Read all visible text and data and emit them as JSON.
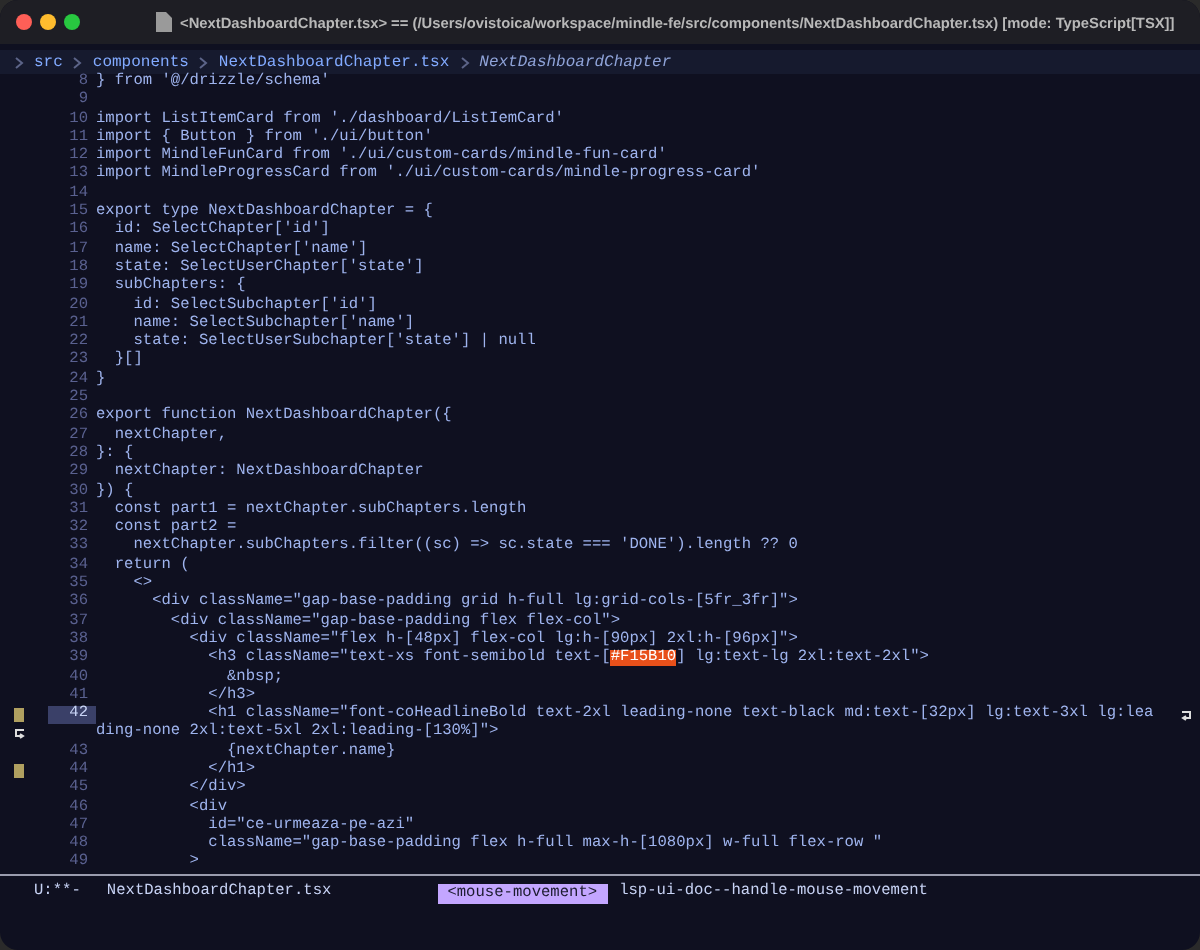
{
  "window": {
    "title": "<NextDashboardChapter.tsx> == (/Users/ovistoica/workspace/mindle-fe/src/components/NextDashboardChapter.tsx) [mode: TypeScript[TSX]]"
  },
  "breadcrumb": [
    "src",
    "components",
    "NextDashboardChapter.tsx",
    "NextDashboardChapter"
  ],
  "lines": [
    {
      "n": "8",
      "text": "} from '@/drizzle/schema'",
      "current": false,
      "marker": false
    },
    {
      "n": "9",
      "current": false,
      "marker": false
    },
    {
      "n": "10",
      "text": "import ListItemCard from './dashboard/ListIemCard'",
      "current": false,
      "marker": false
    },
    {
      "n": "11",
      "text": "import { Button } from './ui/button'",
      "current": false,
      "marker": false
    },
    {
      "n": "12",
      "text": "import MindleFunCard from './ui/custom-cards/mindle-fun-card'",
      "current": false,
      "marker": false
    },
    {
      "n": "13",
      "text": "import MindleProgressCard from './ui/custom-cards/mindle-progress-card'",
      "current": false,
      "marker": false
    },
    {
      "n": "14",
      "current": false,
      "marker": false
    },
    {
      "n": "15",
      "text": "export type NextDashboardChapter = {",
      "current": false,
      "marker": false
    },
    {
      "n": "16",
      "text": "  id: SelectChapter['id']",
      "current": false,
      "marker": false
    },
    {
      "n": "17",
      "text": "  name: SelectChapter['name']",
      "current": false,
      "marker": false
    },
    {
      "n": "18",
      "text": "  state: SelectUserChapter['state']",
      "current": false,
      "marker": false
    },
    {
      "n": "19",
      "text": "  subChapters: {",
      "current": false,
      "marker": false
    },
    {
      "n": "20",
      "text": "    id: SelectSubchapter['id']",
      "current": false,
      "marker": false
    },
    {
      "n": "21",
      "text": "    name: SelectSubchapter['name']",
      "current": false,
      "marker": false
    },
    {
      "n": "22",
      "text": "    state: SelectUserSubchapter['state'] | null",
      "current": false,
      "marker": false
    },
    {
      "n": "23",
      "text": "  }[]",
      "current": false,
      "marker": false
    },
    {
      "n": "24",
      "text": "}",
      "current": false,
      "marker": false
    },
    {
      "n": "25",
      "current": false,
      "marker": false
    },
    {
      "n": "26",
      "text": "export function NextDashboardChapter({",
      "current": false,
      "marker": false
    },
    {
      "n": "27",
      "text": "  nextChapter,",
      "current": false,
      "marker": false
    },
    {
      "n": "28",
      "text": "}: {",
      "current": false,
      "marker": false
    },
    {
      "n": "29",
      "text": "  nextChapter: NextDashboardChapter",
      "current": false,
      "marker": false
    },
    {
      "n": "30",
      "text": "}) {",
      "current": false,
      "marker": false
    },
    {
      "n": "31",
      "text": "  const part1 = nextChapter.subChapters.length",
      "current": false,
      "marker": false
    },
    {
      "n": "32",
      "text": "  const part2 =",
      "current": false,
      "marker": false
    },
    {
      "n": "33",
      "text": "    nextChapter.subChapters.filter((sc) => sc.state === 'DONE').length ?? 0",
      "current": false,
      "marker": false
    },
    {
      "n": "34",
      "text": "  return (",
      "current": false,
      "marker": false
    },
    {
      "n": "35",
      "text": "    <>",
      "current": false,
      "marker": false
    },
    {
      "n": "36",
      "text": "      <div className=\"gap-base-padding grid h-full lg:grid-cols-[5fr_3fr]\">",
      "current": false,
      "marker": false
    },
    {
      "n": "37",
      "text": "        <div className=\"gap-base-padding flex flex-col\">",
      "current": false,
      "marker": false
    },
    {
      "n": "38",
      "text": "          <div className=\"flex h-[48px] flex-col lg:h-[90px] 2xl:h-[96px]\">",
      "current": false,
      "marker": false
    },
    {
      "n": "39",
      "text": "            <h3 className=\"text-xs font-semibold text-[",
      "highlight": "#F15B10",
      "after": "] lg:text-lg 2xl:text-2xl\">",
      "current": false,
      "marker": false
    },
    {
      "n": "40",
      "text": "              &nbsp;",
      "current": false,
      "marker": false
    },
    {
      "n": "41",
      "text": "            </h3>",
      "current": false,
      "marker": false
    },
    {
      "n": "42",
      "text": "            <h1 className=\"font-coHeadlineBold text-2xl leading-none text-black md:text-[32px] lg:text-3xl lg:lea",
      "continuation": "ding-none 2xl:text-5xl 2xl:leading-[130%]\">",
      "current": true,
      "marker": true
    },
    {
      "n": "43",
      "text": "              {nextChapter.name}",
      "current": false,
      "marker": false
    },
    {
      "n": "44",
      "text": "            </h1>",
      "current": false,
      "marker": true
    },
    {
      "n": "45",
      "text": "          </div>",
      "current": false,
      "marker": false
    },
    {
      "n": "46",
      "text": "          <div",
      "current": false,
      "marker": false
    },
    {
      "n": "47",
      "text": "            id=\"ce-urmeaza-pe-azi\"",
      "current": false,
      "marker": false
    },
    {
      "n": "48",
      "text": "            className=\"gap-base-padding flex h-full max-h-[1080px] w-full flex-row \"",
      "current": false,
      "marker": false
    },
    {
      "n": "49",
      "text": "          >",
      "current": false,
      "marker": false
    }
  ],
  "status_bar": {
    "state": "U:**-",
    "buffer": "NextDashboardChapter.tsx",
    "event": "<mouse-movement>",
    "command": "lsp-ui-doc--handle-mouse-movement"
  }
}
